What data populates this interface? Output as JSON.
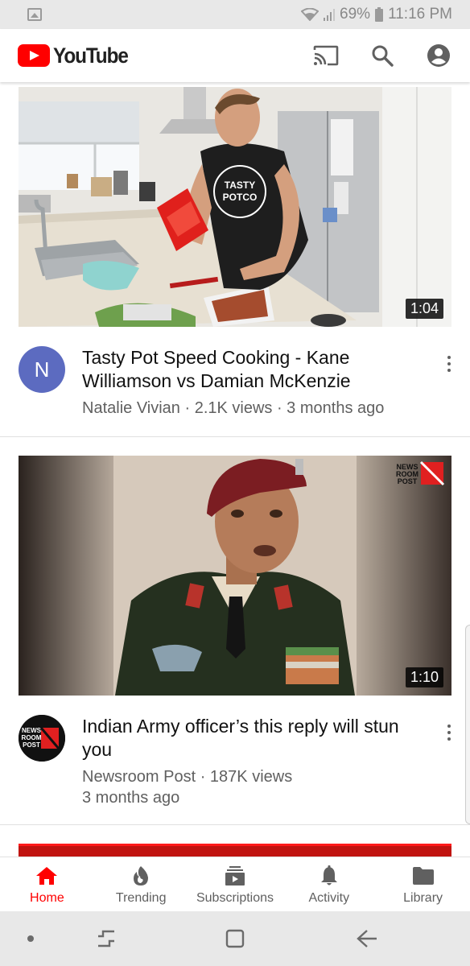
{
  "status_bar": {
    "battery": "69%",
    "time": "11:16 PM",
    "icons": [
      "image-notification-icon",
      "wifi-icon",
      "signal-icon",
      "battery-icon"
    ]
  },
  "app_bar": {
    "logo_text": "YouTube",
    "icons": [
      "cast-icon",
      "search-icon",
      "account-icon"
    ]
  },
  "videos": [
    {
      "title": "Tasty Pot Speed Cooking - Kane Williamson vs Damian McKenzie",
      "channel_line": "Natalie Vivian · 2.1K views · 3 months ago",
      "duration": "1:04",
      "avatar_letter": "N",
      "avatar_color": "#5c6bc0",
      "shirt_text": "TASTY POTCO"
    },
    {
      "title": "Indian Army officer’s this reply will stun you",
      "channel_line": "Newsroom Post · 187K views",
      "age_line": "3 months ago",
      "duration": "1:10",
      "avatar_text": "NEWS ROOM POST",
      "watermark": "NEWS ROOM POST"
    }
  ],
  "bottom_nav": [
    {
      "label": "Home",
      "icon": "home-icon",
      "active": true
    },
    {
      "label": "Trending",
      "icon": "flame-icon",
      "active": false
    },
    {
      "label": "Subscriptions",
      "icon": "subscriptions-icon",
      "active": false
    },
    {
      "label": "Activity",
      "icon": "bell-icon",
      "active": false
    },
    {
      "label": "Library",
      "icon": "folder-icon",
      "active": false
    }
  ],
  "colors": {
    "brand_red": "#ff0000",
    "text_primary": "#111111",
    "text_secondary": "#606060"
  }
}
